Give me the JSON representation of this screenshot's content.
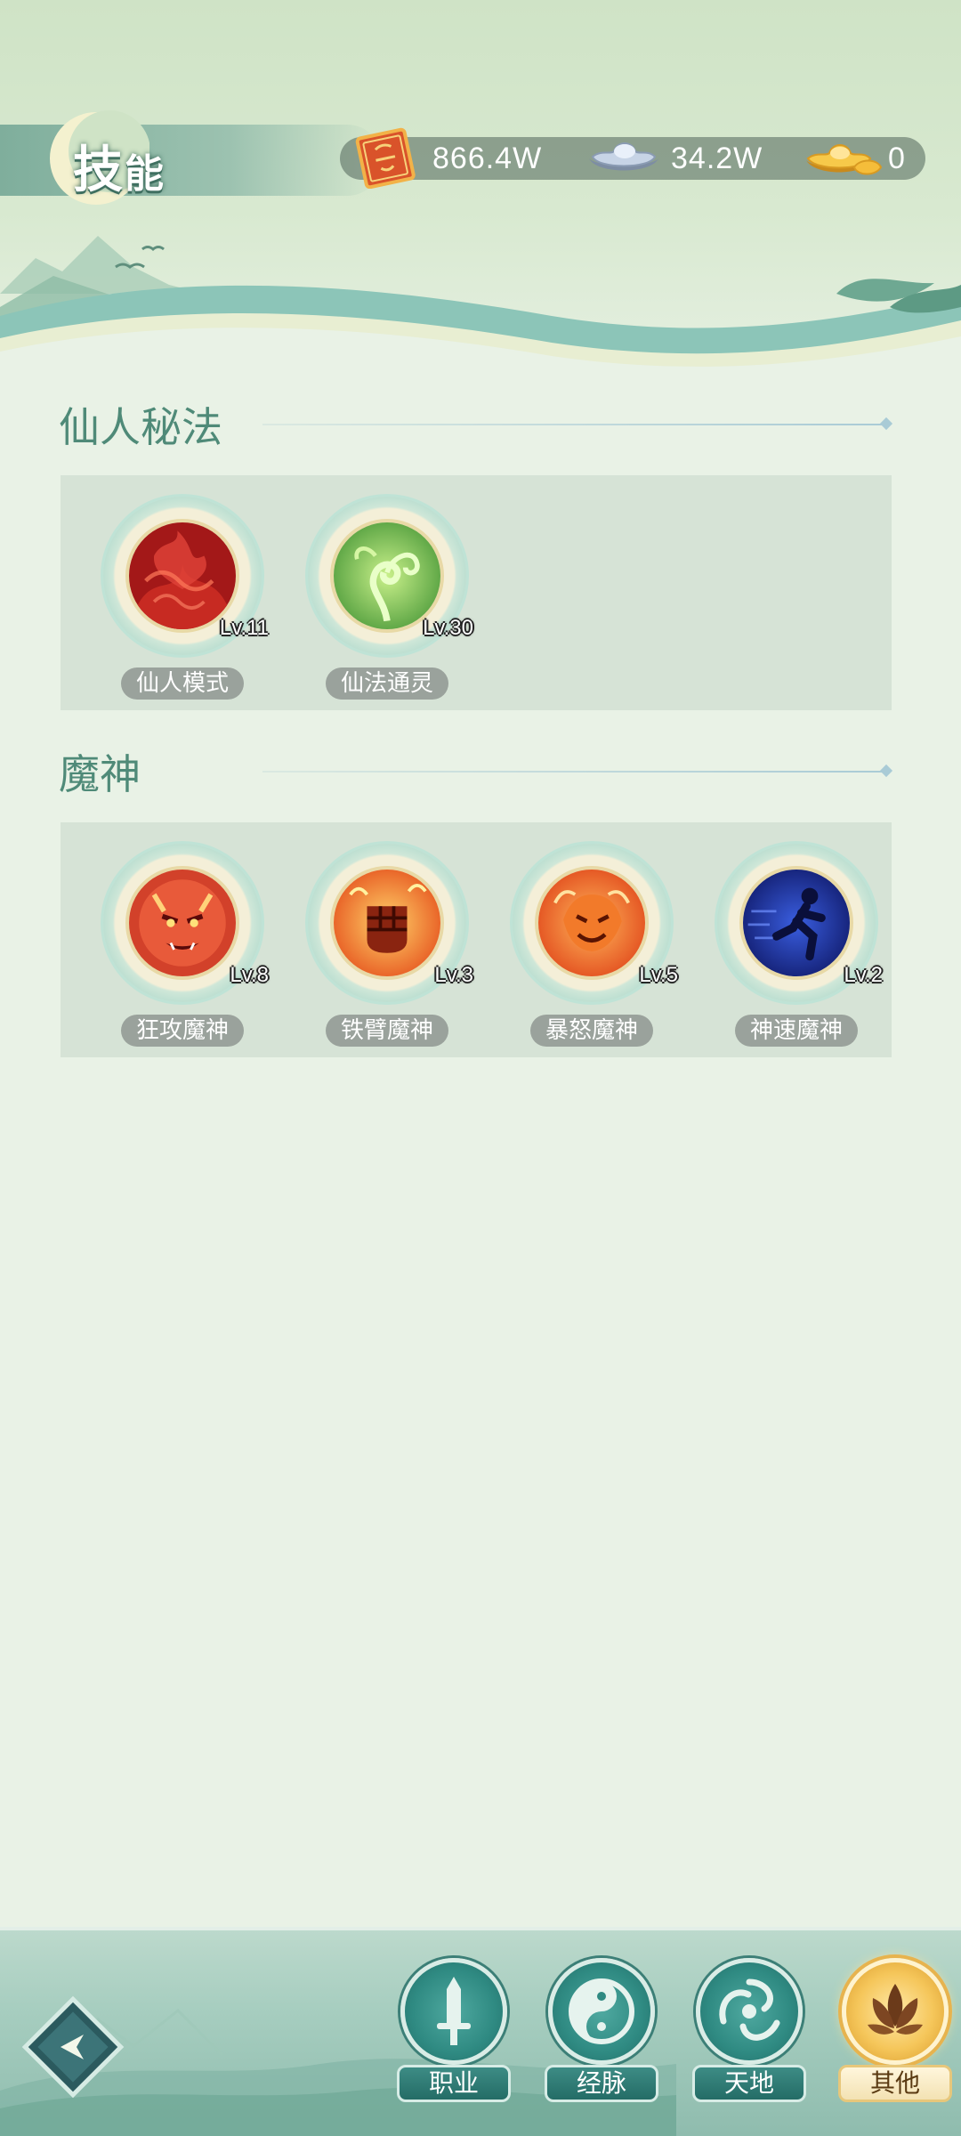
{
  "header": {
    "title_main": "技",
    "title_small": "能",
    "currencies": [
      {
        "icon": "red-token-icon",
        "value": "866.4W"
      },
      {
        "icon": "silver-ingot-icon",
        "value": "34.2W"
      },
      {
        "icon": "gold-ingot-icon",
        "value": "0"
      }
    ]
  },
  "sections": [
    {
      "title": "仙人秘法",
      "skills": [
        {
          "name": "仙人模式",
          "level": "Lv.11",
          "icon": "red-flame-icon"
        },
        {
          "name": "仙法通灵",
          "level": "Lv.30",
          "icon": "green-vine-icon"
        }
      ]
    },
    {
      "title": "魔神",
      "skills": [
        {
          "name": "狂攻魔神",
          "level": "Lv.8",
          "icon": "demon-face-icon"
        },
        {
          "name": "铁臂魔神",
          "level": "Lv.3",
          "icon": "fire-fist-icon"
        },
        {
          "name": "暴怒魔神",
          "level": "Lv.5",
          "icon": "fire-lion-icon"
        },
        {
          "name": "神速魔神",
          "level": "Lv.2",
          "icon": "blue-runner-icon"
        }
      ]
    }
  ],
  "bottom_nav": {
    "back_icon": "back-arrow-icon",
    "items": [
      {
        "label": "职业",
        "icon": "sword-icon",
        "active": false
      },
      {
        "label": "经脉",
        "icon": "taiji-icon",
        "active": false
      },
      {
        "label": "天地",
        "icon": "swirl-icon",
        "active": false
      },
      {
        "label": "其他",
        "icon": "lotus-icon",
        "active": true
      }
    ]
  },
  "colors": {
    "background": "#e9f2e6",
    "section_title": "#4f8a78",
    "panel": "#d6e3d6",
    "nav_teal": "#2f8a82",
    "nav_active_gold": "#f5c65a"
  }
}
